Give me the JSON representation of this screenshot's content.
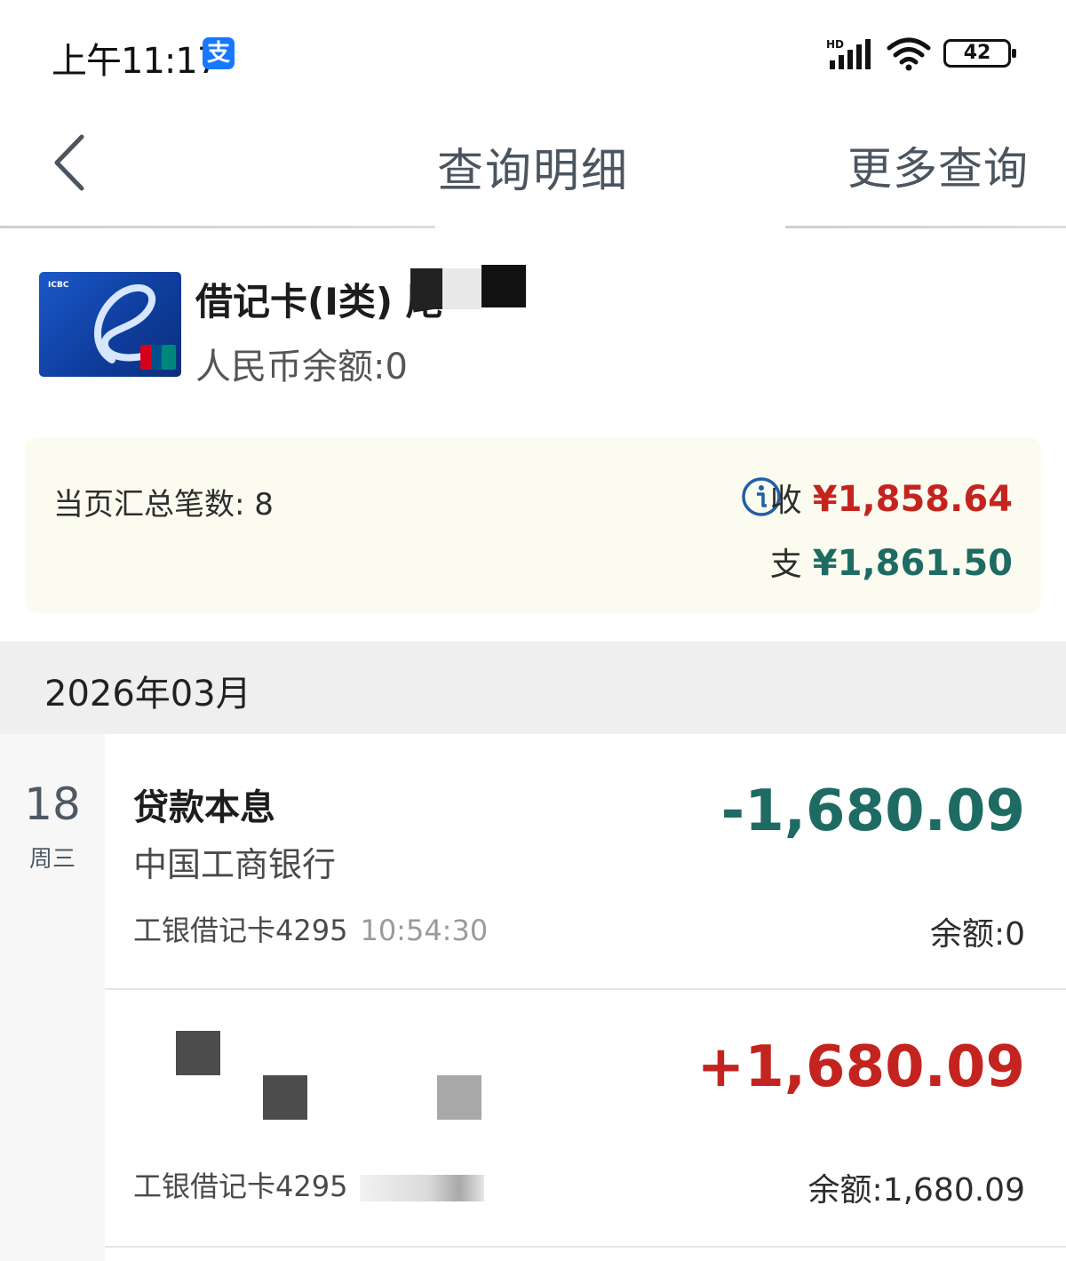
{
  "status_bar": {
    "time": "上午11:17",
    "app_badge": "支",
    "network_label": "HD",
    "battery": "42"
  },
  "header": {
    "title": "查询明细",
    "more_query": "更多查询"
  },
  "card": {
    "image_brand": "ICBC",
    "name": "借记卡(I类) 尾",
    "balance": "人民币余额:0"
  },
  "summary": {
    "count": "当页汇总笔数: 8",
    "income_label": "收",
    "income_amount": "¥1,858.64",
    "expense_label": "支",
    "expense_amount": "¥1,861.50"
  },
  "month": "2026年03月",
  "date_group": {
    "day": "18",
    "weekday": "周三"
  },
  "transactions": [
    {
      "title": "贷款本息",
      "bank": "中国工商银行",
      "account": "工银借记卡4295",
      "time": "10:54:30",
      "amount": "-1,680.09",
      "balance": "余额:0"
    },
    {
      "account": "工银借记卡4295",
      "amount": "+1,680.09",
      "balance": "余额:1,680.09"
    }
  ],
  "colors": {
    "income_red": "#c4241f",
    "expense_green": "#1e6b63",
    "summary_bg": "#fcfbef",
    "icbc_blue": "#1c58c8",
    "info_blue": "#1f5fa8"
  },
  "icons": {
    "back": "chevron-left-icon",
    "info": "info-icon",
    "alipay": "alipay-icon",
    "signal": "signal-icon",
    "wifi": "wifi-icon",
    "battery": "battery-icon"
  }
}
